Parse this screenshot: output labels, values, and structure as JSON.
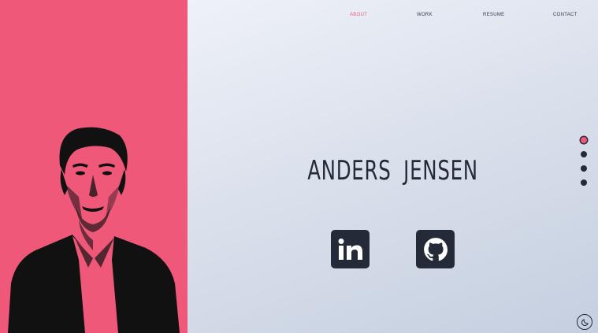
{
  "nav": {
    "items": [
      {
        "label": "ABOUT",
        "active": true
      },
      {
        "label": "WORK",
        "active": false
      },
      {
        "label": "RESUME",
        "active": false
      },
      {
        "label": "CONTACT",
        "active": false
      }
    ]
  },
  "hero": {
    "name": "ANDERS JENSEN"
  },
  "social": {
    "linkedin_icon": "linkedin-icon",
    "github_icon": "github-icon"
  },
  "section_dots": {
    "count": 4,
    "active_index": 0
  },
  "colors": {
    "accent": "#f0587a",
    "dark": "#252a38",
    "background": "#dfe5ef"
  },
  "theme_toggle": {
    "icon": "moon-icon"
  }
}
